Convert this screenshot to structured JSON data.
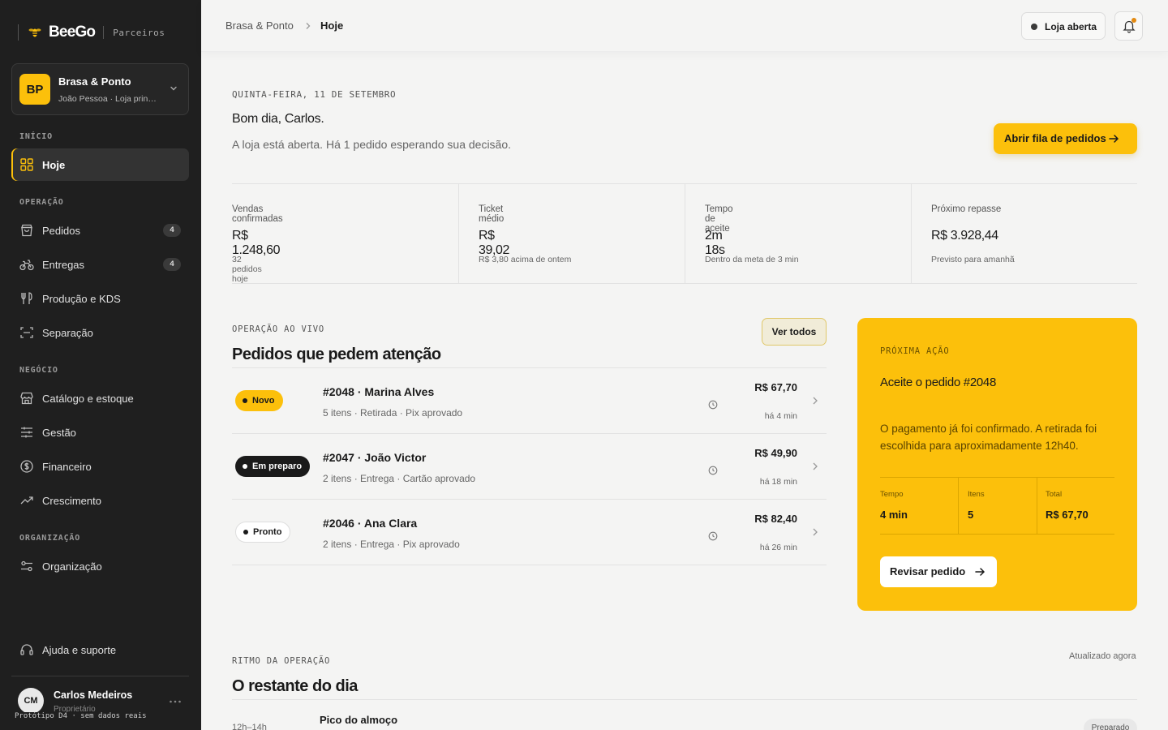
{
  "brand": {
    "logo": "BeeGo",
    "subtitle": "Parceiros"
  },
  "store": {
    "initials": "BP",
    "name": "Brasa & Ponto",
    "location": "João Pessoa · Loja principal"
  },
  "sidebar": {
    "sections": [
      "INÍCIO",
      "OPERAÇÃO",
      "NEGÓCIO",
      "ORGANIZAÇÃO"
    ],
    "items": [
      {
        "label": "Hoje",
        "icon": "grid-icon",
        "active": true
      },
      {
        "label": "Pedidos",
        "icon": "bag-icon",
        "count": "4"
      },
      {
        "label": "Entregas",
        "icon": "bike-icon",
        "count": "4"
      },
      {
        "label": "Produção e KDS",
        "icon": "utensils-icon"
      },
      {
        "label": "Separação",
        "icon": "scan-icon"
      },
      {
        "label": "Catálogo e estoque",
        "icon": "store-icon"
      },
      {
        "label": "Gestão",
        "icon": "sliders-icon"
      },
      {
        "label": "Financeiro",
        "icon": "dollar-icon"
      },
      {
        "label": "Crescimento",
        "icon": "trending-icon"
      },
      {
        "label": "Organização",
        "icon": "settings-icon"
      }
    ],
    "help": "Ajuda e suporte"
  },
  "user": {
    "initials": "CM",
    "name": "Carlos Medeiros",
    "role": "Proprietário"
  },
  "prototype_note": "Protótipo D4 · sem dados reais",
  "topbar": {
    "crumb_parent": "Brasa & Ponto",
    "crumb_current": "Hoje",
    "status": "Loja aberta"
  },
  "header": {
    "date": "QUINTA-FEIRA, 11 DE SETEMBRO",
    "greeting": "Bom dia, Carlos.",
    "message": "A loja está aberta. Há 1 pedido esperando sua decisão.",
    "cta": "Abrir fila de pedidos"
  },
  "metrics": [
    {
      "title": "Vendas confirmadas",
      "value": "R$ 1.248,60",
      "sub": "32 pedidos hoje"
    },
    {
      "title": "Ticket médio",
      "value": "R$ 39,02",
      "sub": "R$ 3,80 acima de ontem"
    },
    {
      "title": "Tempo de aceite",
      "value": "2m 18s",
      "sub": "Dentro da meta de 3 min"
    },
    {
      "title": "Próximo repasse",
      "value": "R$ 3.928,44",
      "sub": "Previsto para amanhã"
    }
  ],
  "orders": {
    "label": "OPERAÇÃO AO VIVO",
    "title": "Pedidos que pedem atenção",
    "see_all": "Ver todos",
    "rows": [
      {
        "status": "Novo",
        "title": "#2048 · Marina Alves",
        "detail": "5 itens · Retirada · Pix aprovado",
        "price": "R$ 67,70",
        "age": "há 4 min"
      },
      {
        "status": "Em preparo",
        "title": "#2047 · João Victor",
        "detail": "2 itens · Entrega · Cartão aprovado",
        "price": "R$ 49,90",
        "age": "há 18 min"
      },
      {
        "status": "Pronto",
        "title": "#2046 · Ana Clara",
        "detail": "2 itens · Entrega · Pix aprovado",
        "price": "R$ 82,40",
        "age": "há 26 min"
      }
    ]
  },
  "next_action": {
    "label": "PRÓXIMA AÇÃO",
    "heading": "Aceite o pedido #2048",
    "text": "O pagamento já foi confirmado. A retirada foi escolhida para aproximadamente 12h40.",
    "stats": [
      {
        "label": "Tempo",
        "value": "4 min"
      },
      {
        "label": "Itens",
        "value": "5"
      },
      {
        "label": "Total",
        "value": "R$ 67,70"
      }
    ],
    "button": "Revisar pedido"
  },
  "rhythm": {
    "label": "RITMO DA OPERAÇÃO",
    "updated": "Atualizado agora",
    "title": "O restante do dia",
    "first_time": "12h–14h",
    "first_name": "Pico do almoço",
    "first_badge": "Preparado"
  },
  "colors": {
    "accent": "#fcc00b",
    "sidebar": "#1f1f1f",
    "background": "#f4f4f3"
  }
}
